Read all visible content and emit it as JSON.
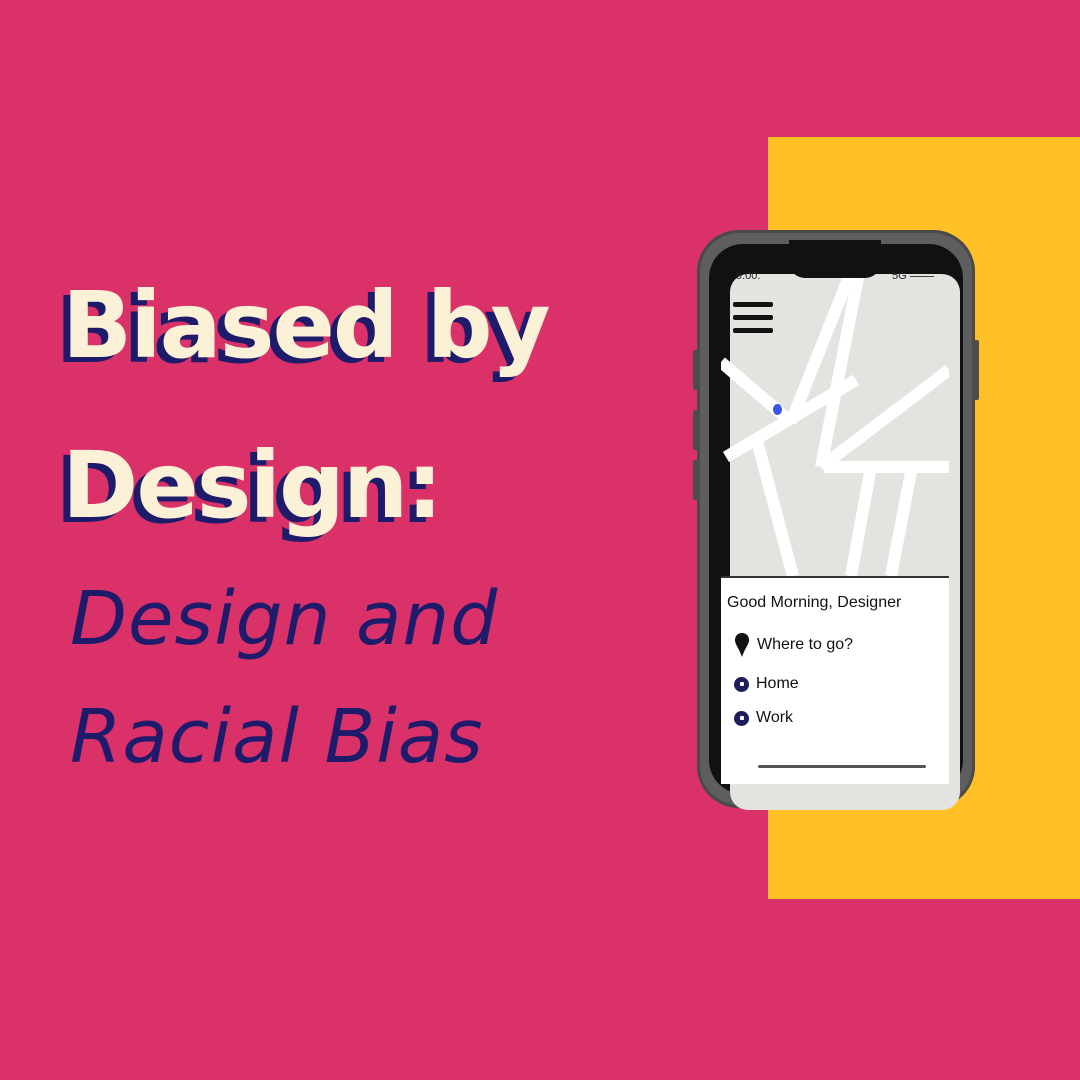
{
  "colors": {
    "background": "#DB3169",
    "accent_block": "#FFC125",
    "title_fill": "#FAF1D6",
    "title_shadow": "#1E1B6B",
    "subtitle": "#1E1B6B"
  },
  "title": {
    "line1": "Biased by",
    "line2": "Design:"
  },
  "subtitle": {
    "line1": "Design and",
    "line2": "Racial Bias"
  },
  "phone": {
    "status": {
      "time": "9:00.",
      "network": "5G"
    },
    "icons": {
      "menu": "hamburger-menu-icon",
      "location": "location-dot-icon",
      "destination": "map-pin-icon",
      "home": "home-icon",
      "work": "work-icon"
    },
    "panel": {
      "greeting": "Good Morning, Designer",
      "search_label": "Where to go?",
      "shortcuts": [
        {
          "label": "Home"
        },
        {
          "label": "Work"
        }
      ]
    }
  }
}
